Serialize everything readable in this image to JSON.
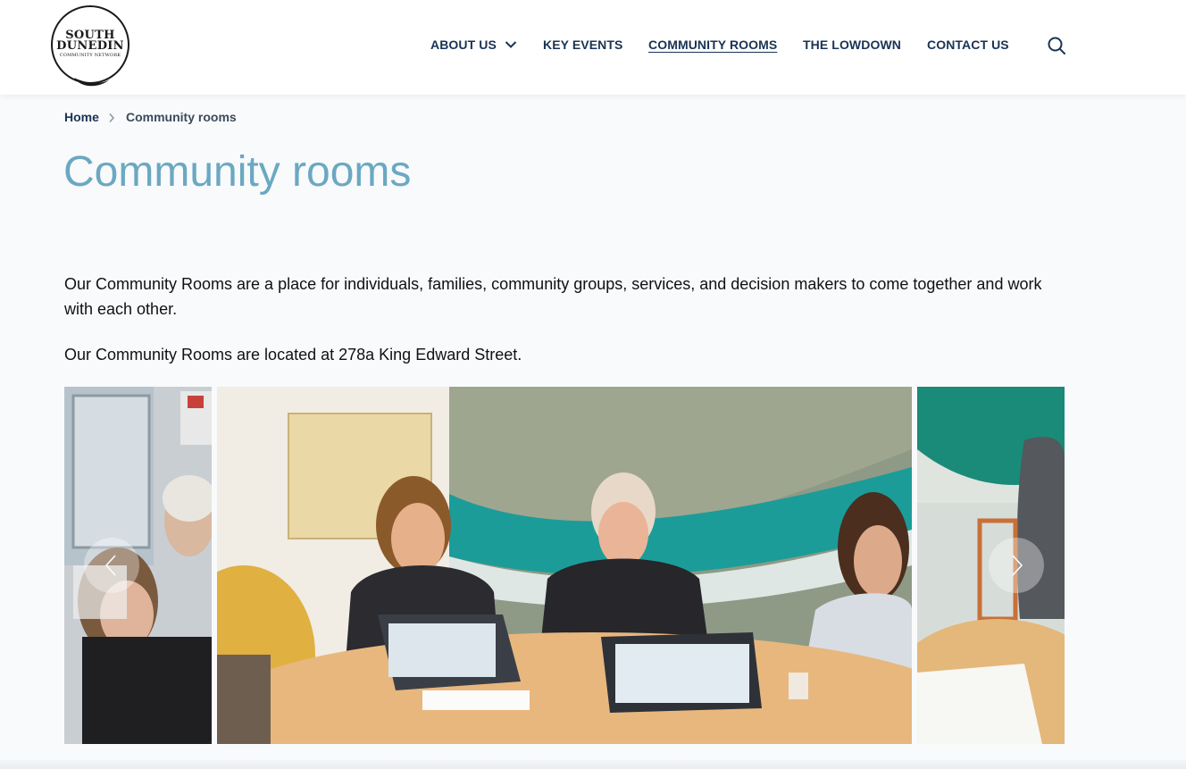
{
  "logo": {
    "line1": "SOUTH",
    "line2": "DUNEDIN",
    "line3": "COMMUNITY NETWORK"
  },
  "nav": {
    "items": [
      {
        "label": "ABOUT US",
        "has_dropdown": true,
        "active": false
      },
      {
        "label": "KEY EVENTS",
        "active": false
      },
      {
        "label": "COMMUNITY ROOMS",
        "active": true
      },
      {
        "label": "THE LOWDOWN",
        "active": false
      },
      {
        "label": "CONTACT US",
        "active": false
      }
    ],
    "search_icon": "search-icon"
  },
  "breadcrumb": {
    "home": "Home",
    "current": "Community rooms"
  },
  "page": {
    "title": "Community rooms",
    "paragraph1": "Our Community Rooms are a place for individuals, families, community groups, services, and decision makers to come together and work with each other.",
    "paragraph2": "Our Community Rooms are located at 278a King Edward Street."
  },
  "carousel": {
    "slides": [
      {
        "position": "previous",
        "subject": "group-meeting-photo"
      },
      {
        "position": "current",
        "subject": "community-meeting-with-laptops-photo"
      },
      {
        "position": "next",
        "subject": "table-with-papers-photo"
      }
    ],
    "prev_icon": "chevron-left-icon",
    "next_icon": "chevron-right-icon"
  },
  "colors": {
    "nav_text": "#1a3354",
    "title": "#6ba8c2",
    "background": "#f9fafb"
  }
}
